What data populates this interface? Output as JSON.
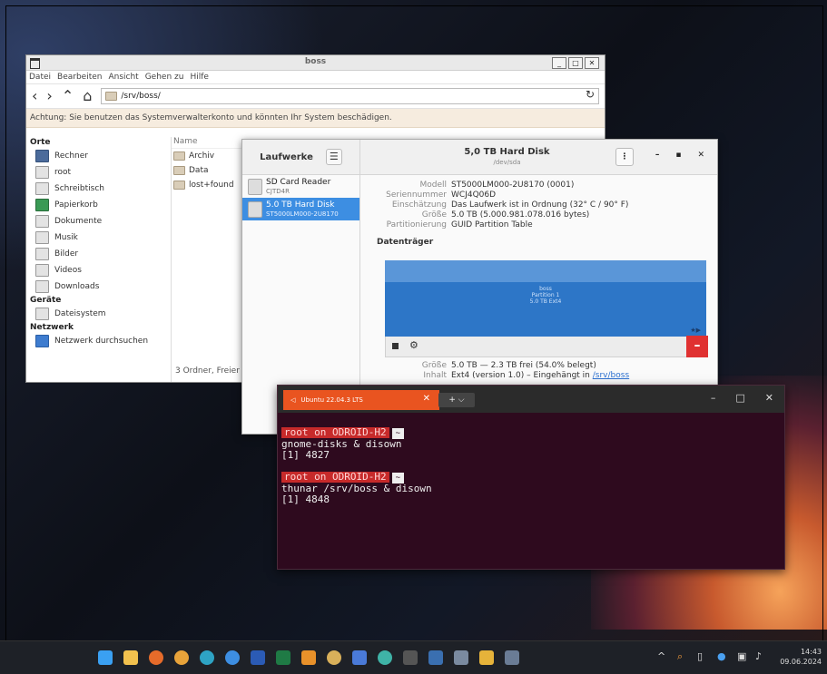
{
  "thunar": {
    "title": "boss",
    "menu": [
      "Datei",
      "Bearbeiten",
      "Ansicht",
      "Gehen zu",
      "Hilfe"
    ],
    "path": "/srv/boss/",
    "warning": "Achtung: Sie benutzen das Systemverwalterkonto und könnten Ihr System beschädigen.",
    "sidebar": {
      "places_header": "Orte",
      "places": [
        "Rechner",
        "root",
        "Schreibtisch",
        "Papierkorb",
        "Dokumente",
        "Musik",
        "Bilder",
        "Videos",
        "Downloads"
      ],
      "devices_header": "Geräte",
      "devices": [
        "Dateisystem"
      ],
      "network_header": "Netzwerk",
      "network": [
        "Netzwerk durchsuchen"
      ]
    },
    "column_name": "Name",
    "files": [
      "Archiv",
      "Data",
      "lost+found"
    ],
    "status": "3 Ordner, Freier"
  },
  "disks": {
    "header_left": "Laufwerke",
    "title": "5,0 TB Hard Disk",
    "subtitle": "/dev/sda",
    "devices": [
      {
        "name": "SD Card Reader",
        "sub": "CJTD4R"
      },
      {
        "name": "5.0 TB Hard Disk",
        "sub": "ST5000LM000-2U8170"
      }
    ],
    "props": [
      {
        "k": "Modell",
        "v": "ST5000LM000-2U8170 (0001)"
      },
      {
        "k": "Seriennummer",
        "v": "WCJ4Q06D"
      },
      {
        "k": "Einschätzung",
        "v": "Das Laufwerk ist in Ordnung (32° C / 90° F)"
      },
      {
        "k": "Größe",
        "v": "5.0 TB (5.000.981.078.016 bytes)"
      },
      {
        "k": "Partitionierung",
        "v": "GUID Partition Table"
      }
    ],
    "volumes_header": "Datenträger",
    "volume_label": [
      "boss",
      "Partition 1",
      "5.0 TB Ext4"
    ],
    "size_key": "Größe",
    "size_value": "5.0 TB — 2.3 TB frei (54.0% belegt)",
    "content_key": "Inhalt",
    "content_value": "Ext4 (version 1.0) – Eingehängt in",
    "content_link": "/srv/boss"
  },
  "terminal": {
    "tab_title": "Ubuntu 22.04.3 LTS",
    "prompt": "root on ODROID-H2",
    "tilde": "~",
    "cmd1": "gnome-disks  & disown",
    "out1": "[1] 4827",
    "cmd2": "thunar /srv/boss  & disown",
    "out2": "[1] 4848"
  },
  "taskbar": {
    "time": "14:43",
    "date": "09.06.2024"
  },
  "colors": {
    "ubuntu_orange": "#e95420",
    "terminal_bg": "#2e0a1e",
    "disk_selected": "#3d8ee2",
    "partition_blue": "#2d76c7",
    "delete_red": "#e03131"
  }
}
